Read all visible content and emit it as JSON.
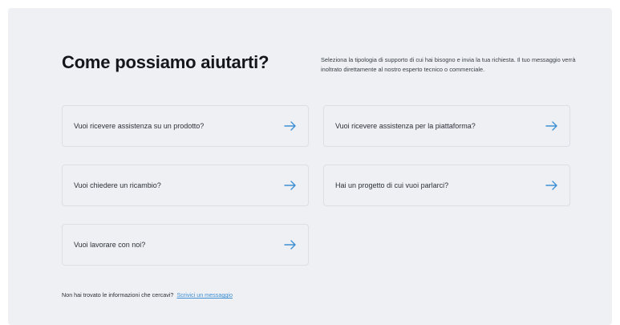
{
  "heading": "Come possiamo aiutarti?",
  "intro": "Seleziona la tipologia di supporto di cui hai bisogno e invia la tua richiesta. Il tuo messaggio verrà inoltrato direttamente al nostro esperto tecnico o commerciale.",
  "options": [
    {
      "label": "Vuoi ricevere assistenza su un prodotto?"
    },
    {
      "label": "Vuoi ricevere assistenza per la piattaforma?"
    },
    {
      "label": "Vuoi chiedere un ricambio?"
    },
    {
      "label": "Hai un progetto di cui vuoi parlarci?"
    },
    {
      "label": "Vuoi lavorare con noi?"
    }
  ],
  "footer": {
    "text": "Non hai trovato le informazioni che cercavi?",
    "link": "Scrivici un messaggio"
  },
  "colors": {
    "accent": "#3d8fd6",
    "panel": "#eef0f3"
  },
  "icons": {
    "option_arrow": "arrow-right-icon"
  }
}
